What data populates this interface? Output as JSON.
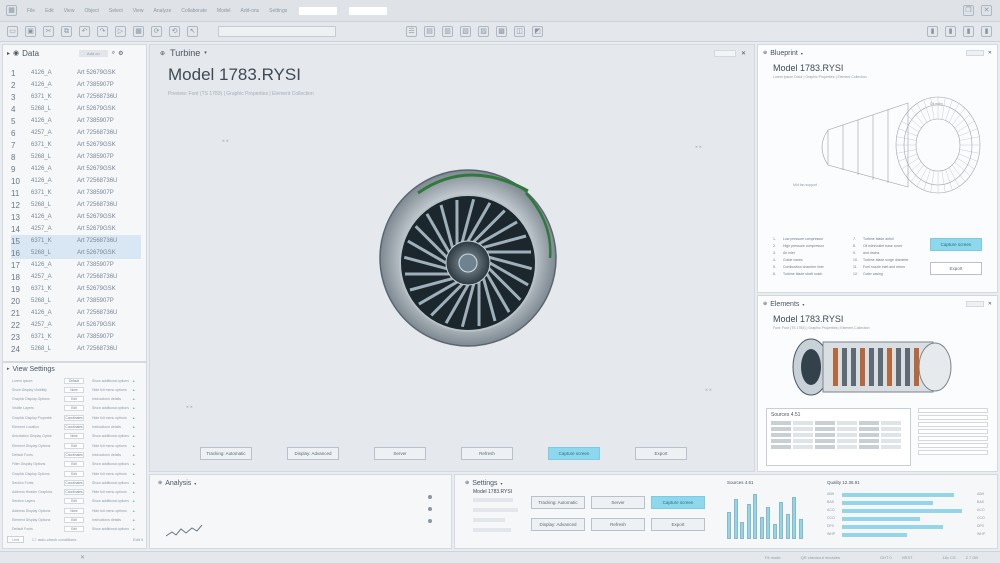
{
  "menubar": {
    "items": [
      "File",
      "Edit",
      "View",
      "Object",
      "Select",
      "View",
      "Analyze",
      "Collaborate",
      "Model",
      "Add-ons",
      "Settings"
    ]
  },
  "data_panel": {
    "title": "Data",
    "add_label": "Add on",
    "rows": [
      {
        "n": "1",
        "a": "4126_A",
        "b": "Art 52679GSK"
      },
      {
        "n": "2",
        "a": "4126_A",
        "b": "Art 7385907P"
      },
      {
        "n": "3",
        "a": "6371_K",
        "b": "Art 72568736U"
      },
      {
        "n": "4",
        "a": "5268_L",
        "b": "Art 52679GSK"
      },
      {
        "n": "5",
        "a": "4126_A",
        "b": "Art 7385907P"
      },
      {
        "n": "6",
        "a": "4257_A",
        "b": "Art 72568736U"
      },
      {
        "n": "7",
        "a": "6371_K",
        "b": "Art 52679GSK"
      },
      {
        "n": "8",
        "a": "5268_L",
        "b": "Art 7385907P"
      },
      {
        "n": "9",
        "a": "4126_A",
        "b": "Art 52679GSK"
      },
      {
        "n": "10",
        "a": "4126_A",
        "b": "Art 72568736U"
      },
      {
        "n": "11",
        "a": "6371_K",
        "b": "Art 7385907P"
      },
      {
        "n": "12",
        "a": "5268_L",
        "b": "Art 72568736U"
      },
      {
        "n": "13",
        "a": "4126_A",
        "b": "Art 52679GSK"
      },
      {
        "n": "14",
        "a": "4257_A",
        "b": "Art 52679GSK"
      },
      {
        "n": "15",
        "a": "6371_K",
        "b": "Art 72568736U"
      },
      {
        "n": "16",
        "a": "5268_L",
        "b": "Art 52679GSK"
      },
      {
        "n": "17",
        "a": "4126_A",
        "b": "Art 7385907P"
      },
      {
        "n": "18",
        "a": "4257_A",
        "b": "Art 72568736U"
      },
      {
        "n": "19",
        "a": "6371_K",
        "b": "Art 52679GSK"
      },
      {
        "n": "20",
        "a": "5268_L",
        "b": "Art 7385907P"
      },
      {
        "n": "21",
        "a": "4126_A",
        "b": "Art 72568736U"
      },
      {
        "n": "22",
        "a": "4257_A",
        "b": "Art 52679GSK"
      },
      {
        "n": "23",
        "a": "6371_K",
        "b": "Art 7385907P"
      },
      {
        "n": "24",
        "a": "5268_L",
        "b": "Art 72568736U"
      }
    ]
  },
  "view_settings": {
    "title": "View Settings",
    "rows": [
      {
        "label": "Lorem Ipsum",
        "pill": "Default",
        "note": "Show additional options"
      },
      {
        "label": "Show Display Visibility",
        "pill": "None",
        "note": "Hide full menu options"
      },
      {
        "label": "Graphic Display Options",
        "pill": "Edit",
        "note": "Instructions details"
      },
      {
        "label": "Visible Layers",
        "pill": "Edit",
        "note": "Show additional options"
      },
      {
        "label": "Graphic Display Properties",
        "pill": "Coordinates",
        "note": "Hide full menu options"
      },
      {
        "label": "Element Location",
        "pill": "Coordinates",
        "note": "Instructions details"
      },
      {
        "label": "Annotation Display Options",
        "pill": "None",
        "note": "Show additional options"
      },
      {
        "label": "Element Display Options",
        "pill": "Edit",
        "note": "Hide full menu options"
      },
      {
        "label": "Default Fonts",
        "pill": "Coordinates",
        "note": "Instructions details"
      },
      {
        "label": "Filter Display Options",
        "pill": "Edit",
        "note": "Show additional options"
      },
      {
        "label": "Graphic Display Options",
        "pill": "Edit",
        "note": "Hide full menu options"
      },
      {
        "label": "Section Fonts",
        "pill": "Coordinates",
        "note": "Show additional options"
      },
      {
        "label": "Address Header Graphics",
        "pill": "Coordinates",
        "note": "Hide full menu options"
      },
      {
        "label": "Section Layers",
        "pill": "Edit",
        "note": "Show additional options"
      },
      {
        "label": "Address Display Options",
        "pill": "None",
        "note": "Hide full menu options"
      },
      {
        "label": "Element Display Options",
        "pill": "Edit",
        "note": "Instructions details"
      },
      {
        "label": "Default Fonts",
        "pill": "Edit",
        "note": "Show additional options"
      }
    ],
    "footer_select": "Unit",
    "footer_check": "auto-check conditions",
    "footer_right": "Edit it"
  },
  "main": {
    "tab": "Turbine",
    "title": "Model 1783.RYSI",
    "subtitle": "Preview: Font (TS 1783) | Graphic Properties | Element Collection",
    "buttons": [
      "Tracking: Automatic",
      "Display: Advanced",
      "Server",
      "Refresh",
      "Capture screen",
      "Export"
    ]
  },
  "blueprint": {
    "title": "Blueprint",
    "model": "Model 1783.RYSI",
    "subtitle": "Lorem ipsum Dolor | Graphic Properties | Element Collection",
    "callouts": [
      "Oil entry",
      "Mid fan support"
    ],
    "legend_left": [
      "Low pressure compressor",
      "High pressure compressor",
      "Air inlet",
      "Guide vanes",
      "Combustion chamber liner",
      "Turbine blade shaft notch"
    ],
    "legend_right": [
      "Turbine blade airfoil",
      "Oil inlet/outlet base cover",
      "and drains",
      "Turbine blade surge diameter",
      "Fuel nozzle inlet and return",
      "Outer casing"
    ],
    "capture": "Capture screen",
    "export": "Export"
  },
  "elements": {
    "title": "Elements",
    "model": "Model 1783.RYSI",
    "subtitle": "Font: Font (TS 1783) | Graphic Properties | Element Collection",
    "sources_title": "Sources 4.51"
  },
  "analysis": {
    "title": "Analysis"
  },
  "settings": {
    "title": "Settings",
    "model": "Model 1783.RYSI",
    "buttons": [
      "Tracking: Automatic",
      "Server",
      "Capture screen",
      "Display: Advanced",
      "Refresh",
      "Export"
    ],
    "sources_title": "Sources 4.51",
    "quality_title": "Quality 12.36.91",
    "quality_labels": [
      "ABH",
      "BAS",
      "ACO",
      "CCO",
      "DPX",
      "WHP"
    ],
    "quality_values": [
      0.86,
      0.7,
      0.92,
      0.6,
      0.78,
      0.5
    ],
    "sources_values": [
      0.55,
      0.8,
      0.35,
      0.7,
      0.9,
      0.45,
      0.65,
      0.3,
      0.75,
      0.5,
      0.85,
      0.4
    ]
  },
  "status": {
    "left": "",
    "center_a": "Fit mode",
    "center_b": "QR checkout modules",
    "right_a": "GHT 0",
    "right_b": "HRST",
    "right_c": "16x CS",
    "right_d": "2 7 DB",
    "accent": "#8ed8ee"
  }
}
